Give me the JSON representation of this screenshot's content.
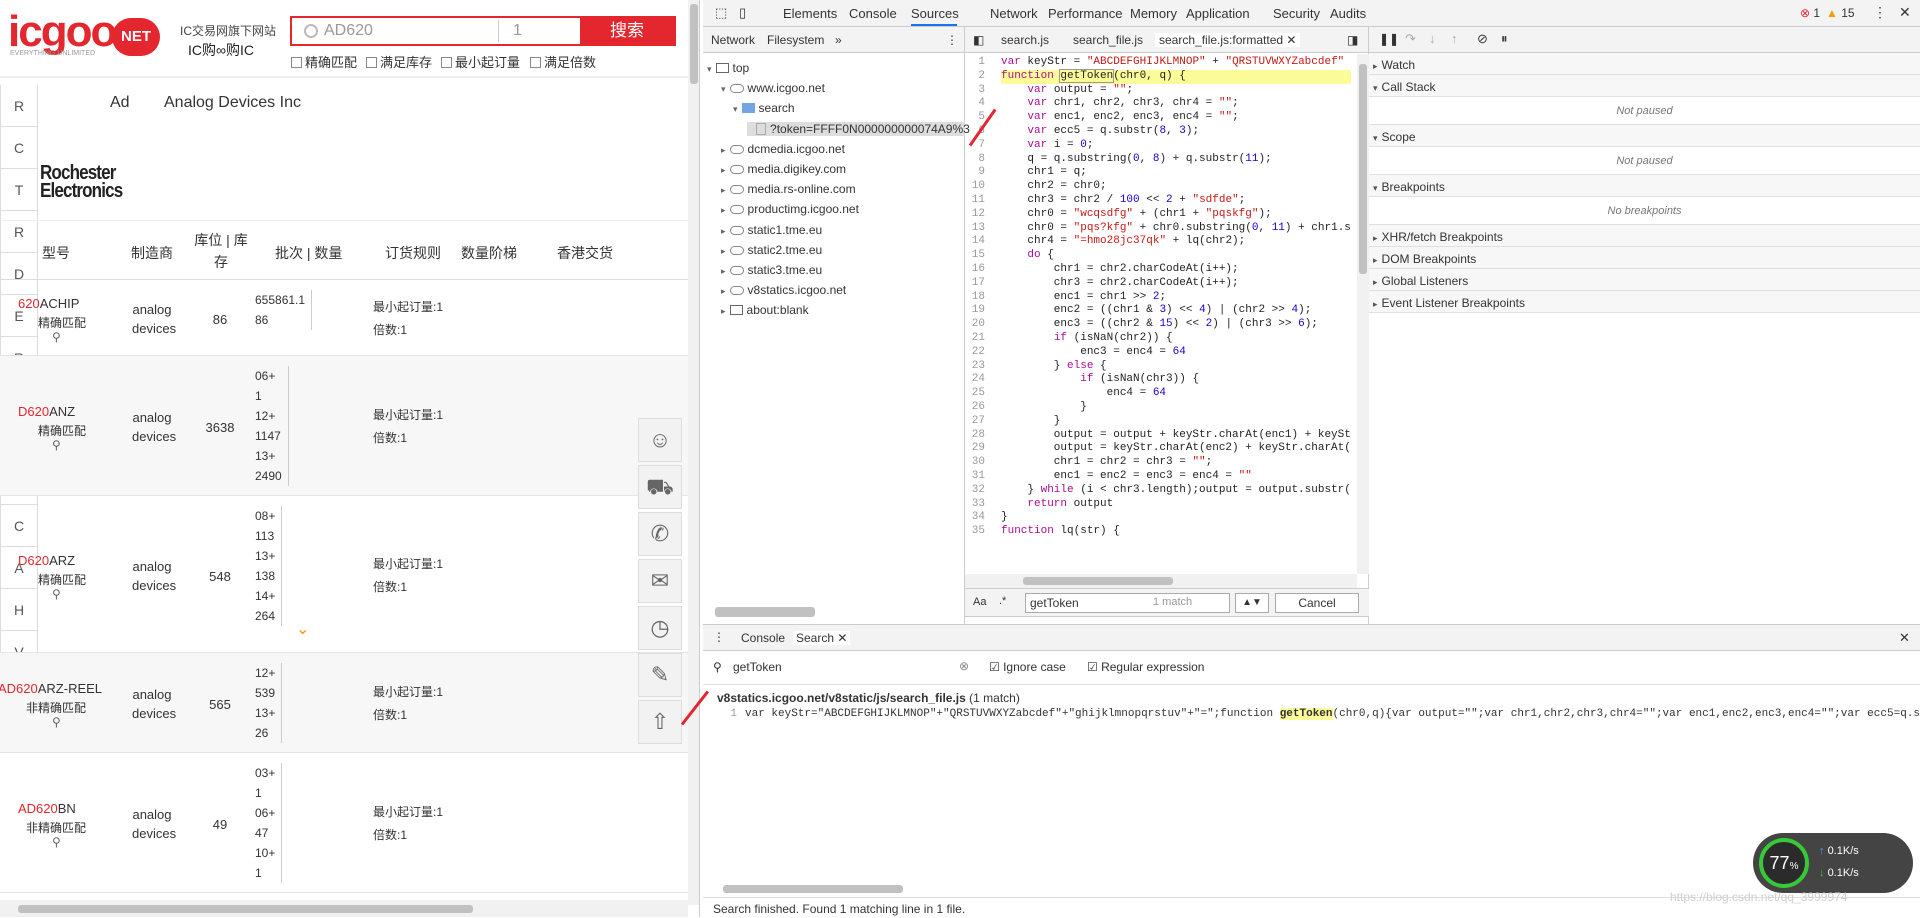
{
  "site": {
    "logo": "icgoo",
    "logo_net": "NET",
    "logo_sub": "EVERYTHING UNLIMITED",
    "slogan1": "IC交易网旗下网站",
    "slogan2": "IC购∞购IC",
    "search_value": "AD620",
    "qty_value": "1",
    "search_button": "搜索",
    "checks": [
      "精确匹配",
      "满足库存",
      "最小起订量",
      "满足倍数"
    ],
    "letters": [
      "R",
      "C",
      "T",
      "R",
      "D",
      "E",
      "R",
      "B",
      "E",
      "D",
      "C",
      "A",
      "H",
      "V"
    ],
    "brand_tag": "Ad",
    "brand_name": "Analog Devices Inc",
    "supplier": "Rochester Electronics",
    "headers": [
      "型号",
      "制造商",
      "库位 | 库存",
      "批次 | 数量",
      "订货规则",
      "数量阶梯",
      "香港交货"
    ],
    "rows": [
      {
        "pn_red": "620",
        "pn": "ACHIP",
        "sub": "精确匹配",
        "mfr": "analog devices",
        "stock": "86",
        "batches": [
          "655861.1",
          "86"
        ],
        "rule1": "最小起订量:1",
        "rule2": "倍数:1"
      },
      {
        "pn_red": "D620",
        "pn": "ANZ",
        "sub": "精确匹配",
        "mfr": "analog devices",
        "stock": "3638",
        "batches": [
          "06+",
          "1",
          "12+",
          "1147",
          "13+",
          "2490"
        ],
        "rule1": "最小起订量:1",
        "rule2": "倍数:1"
      },
      {
        "pn_red": "D620",
        "pn": "ARZ",
        "sub": "精确匹配",
        "mfr": "analog devices",
        "stock": "548",
        "batches": [
          "08+",
          "113",
          "13+",
          "138",
          "14+",
          "264"
        ],
        "rule1": "最小起订量:1",
        "rule2": "倍数:1"
      },
      {
        "pn_red": "AD620",
        "pn": "ARZ-REEL",
        "sub": "非精确匹配",
        "mfr": "analog devices",
        "stock": "565",
        "batches": [
          "12+",
          "539",
          "13+",
          "26"
        ],
        "rule1": "最小起订量:1",
        "rule2": "倍数:1"
      },
      {
        "pn_red": "AD620",
        "pn": "BN",
        "sub": "非精确匹配",
        "mfr": "analog devices",
        "stock": "49",
        "batches": [
          "03+",
          "1",
          "06+",
          "47",
          "10+",
          "1"
        ],
        "rule1": "最小起订量:1",
        "rule2": "倍数:1"
      }
    ]
  },
  "devtools": {
    "tabs": [
      "Elements",
      "Console",
      "Sources",
      "Network",
      "Performance",
      "Memory",
      "Application",
      "Security",
      "Audits"
    ],
    "errors": "1",
    "warnings": "15",
    "nav_tabs": [
      "Network",
      "Filesystem"
    ],
    "tree": [
      {
        "label": "top",
        "icon": "frame"
      },
      {
        "label": "www.icgoo.net",
        "icon": "cloud"
      },
      {
        "label": "search",
        "icon": "folder"
      },
      {
        "label": "?token=FFFF0N000000000074A9%3",
        "icon": "file"
      },
      {
        "label": "dcmedia.icgoo.net",
        "icon": "cloud"
      },
      {
        "label": "media.digikey.com",
        "icon": "cloud"
      },
      {
        "label": "media.rs-online.com",
        "icon": "cloud"
      },
      {
        "label": "productimg.icgoo.net",
        "icon": "cloud"
      },
      {
        "label": "static1.tme.eu",
        "icon": "cloud"
      },
      {
        "label": "static2.tme.eu",
        "icon": "cloud"
      },
      {
        "label": "static3.tme.eu",
        "icon": "cloud"
      },
      {
        "label": "v8statics.icgoo.net",
        "icon": "cloud"
      },
      {
        "label": "about:blank",
        "icon": "frame"
      }
    ],
    "editor_tabs": [
      "search.js",
      "search_file.js",
      "search_file.js:formatted"
    ],
    "code": [
      "var keyStr = \"ABCDEFGHIJKLMNOP\" + \"QRSTUVWXYZabcdef\"",
      "function getToken(chr0, q) {",
      "    var output = \"\";",
      "    var chr1, chr2, chr3, chr4 = \"\";",
      "    var enc1, enc2, enc3, enc4 = \"\";",
      "    var ecc5 = q.substr(8, 3);",
      "    var i = 0;",
      "    q = q.substring(0, 8) + q.substr(11);",
      "    chr1 = q;",
      "    chr2 = chr0;",
      "    chr3 = chr2 / 100 << 2 + \"sdfde\";",
      "    chr0 = \"wcqsdfg\" + (chr1 + \"pqskfg\");",
      "    chr0 = \"pqs?kfg\" + chr0.substring(0, 11) + chr1.s",
      "    chr4 = \"=hmo28jc37qk\" + lq(chr2);",
      "    do {",
      "        chr1 = chr2.charCodeAt(i++);",
      "        chr3 = chr2.charCodeAt(i++);",
      "        enc1 = chr1 >> 2;",
      "        enc2 = ((chr1 & 3) << 4) | (chr2 >> 4);",
      "        enc3 = ((chr2 & 15) << 2) | (chr3 >> 6);",
      "        if (isNaN(chr2)) {",
      "            enc3 = enc4 = 64",
      "        } else {",
      "            if (isNaN(chr3)) {",
      "                enc4 = 64",
      "            }",
      "        }",
      "        output = output + keyStr.charAt(enc1) + keySt",
      "        output = keyStr.charAt(enc2) + keyStr.charAt(",
      "        chr1 = chr2 = chr3 = \"\";",
      "        enc1 = enc2 = enc3 = enc4 = \"\"",
      "    } while (i < chr3.length);output = output.substr(",
      "    return output",
      "}",
      "function lq(str) {"
    ],
    "find_value": "getToken",
    "find_count": "1 match",
    "find_cancel": "Cancel",
    "status": "Line 2, Column 10",
    "sections": [
      {
        "title": "Watch",
        "body": ""
      },
      {
        "title": "Call Stack",
        "body": "Not paused"
      },
      {
        "title": "Scope",
        "body": "Not paused"
      },
      {
        "title": "Breakpoints",
        "body": "No breakpoints"
      },
      {
        "title": "XHR/fetch Breakpoints",
        "body": ""
      },
      {
        "title": "DOM Breakpoints",
        "body": ""
      },
      {
        "title": "Global Listeners",
        "body": ""
      },
      {
        "title": "Event Listener Breakpoints",
        "body": ""
      }
    ],
    "drawer_tabs": [
      "Console",
      "Search"
    ],
    "search_query": "getToken",
    "ignore_case": "Ignore case",
    "regex": "Regular expression",
    "result_file": "v8statics.icgoo.net/v8static/js/search_file.js",
    "result_count": "(1 match)",
    "result_line_no": "1",
    "result_pre": "var keyStr=\"ABCDEFGHIJKLMNOP\"+\"QRSTUVWXYZabcdef\"+\"ghijklmnopqrstuv\"+\"=\";function ",
    "result_match": "getToken",
    "result_post": "(chr0,q){var output=\"\";var chr1,chr2,chr3,chr4=\"\";var enc1,enc2,enc3,enc4=\"\";var ecc5=q.s",
    "drawer_status": "Search finished.  Found 1 matching line in 1 file."
  },
  "overlay": {
    "percent": "77",
    "unit": "%",
    "up": "0.1K/s",
    "down": "0.1K/s",
    "watermark": "https://blog.csdn.net/qq_3999974"
  }
}
